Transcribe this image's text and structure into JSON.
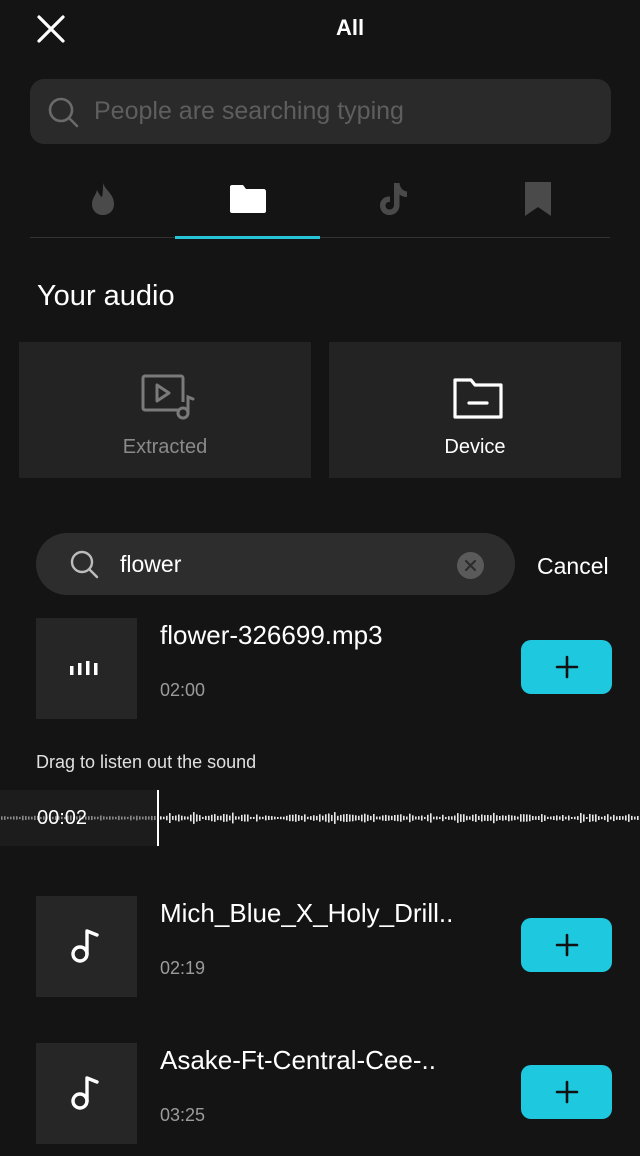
{
  "header": {
    "title": "All"
  },
  "search": {
    "placeholder": "People are searching typing"
  },
  "tabs": [
    {
      "icon": "flame-icon",
      "active": false
    },
    {
      "icon": "folder-icon",
      "active": true
    },
    {
      "icon": "tiktok-icon",
      "active": false
    },
    {
      "icon": "bookmark-icon",
      "active": false
    }
  ],
  "your_audio": {
    "title": "Your audio",
    "cards": [
      {
        "label": "Extracted",
        "icon": "video-music-icon",
        "label_color": "#8a8a8a"
      },
      {
        "label": "Device",
        "icon": "folder-minus-icon",
        "label_color": "#ffffff"
      }
    ]
  },
  "filter": {
    "value": "flower",
    "cancel_label": "Cancel"
  },
  "tracks": [
    {
      "name": "flower-326699.mp3",
      "duration": "02:00",
      "icon": "equalizer-icon",
      "playing": true
    },
    {
      "name": "Mich_Blue_X_Holy_Drill..",
      "duration": "02:19",
      "icon": "music-note-icon"
    },
    {
      "name": "Asake-Ft-Central-Cee-..",
      "duration": "03:25",
      "icon": "music-note-icon"
    }
  ],
  "player": {
    "hint": "Drag to listen out the sound",
    "time": "00:02"
  },
  "colors": {
    "accent": "#1ec9e0",
    "tab_indicator": "#27c3d9",
    "background": "#141414"
  }
}
